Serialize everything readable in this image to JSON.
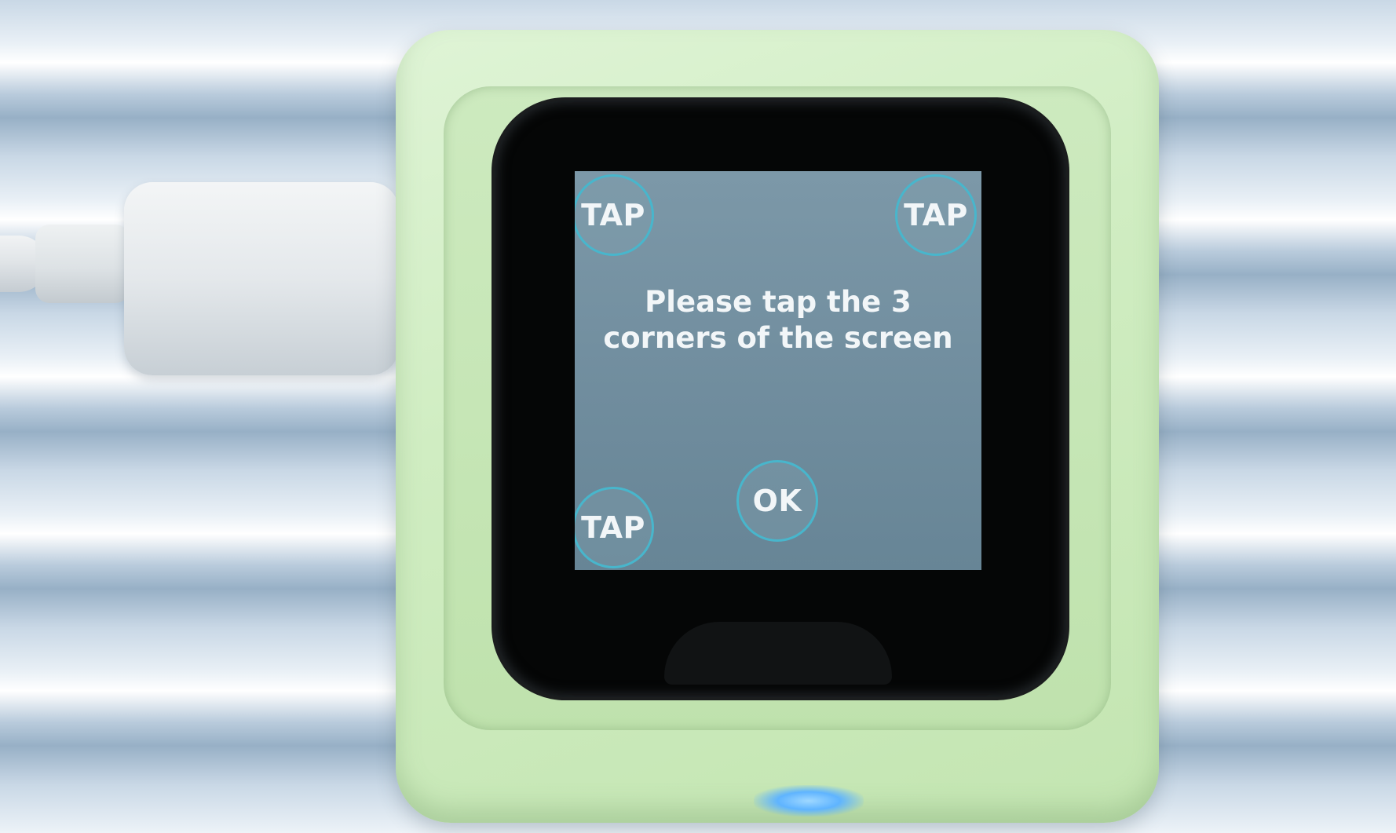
{
  "calibration": {
    "tap_top_left": "TAP",
    "tap_top_right": "TAP",
    "tap_bottom_left": "TAP",
    "message_line1": "Please tap the 3",
    "message_line2": "corners of the screen",
    "ok_label": "OK"
  },
  "colors": {
    "screen": "#728fa0",
    "button_ring": "#48b6cc",
    "text": "#f2f6f8",
    "case": "#cdeabf"
  }
}
